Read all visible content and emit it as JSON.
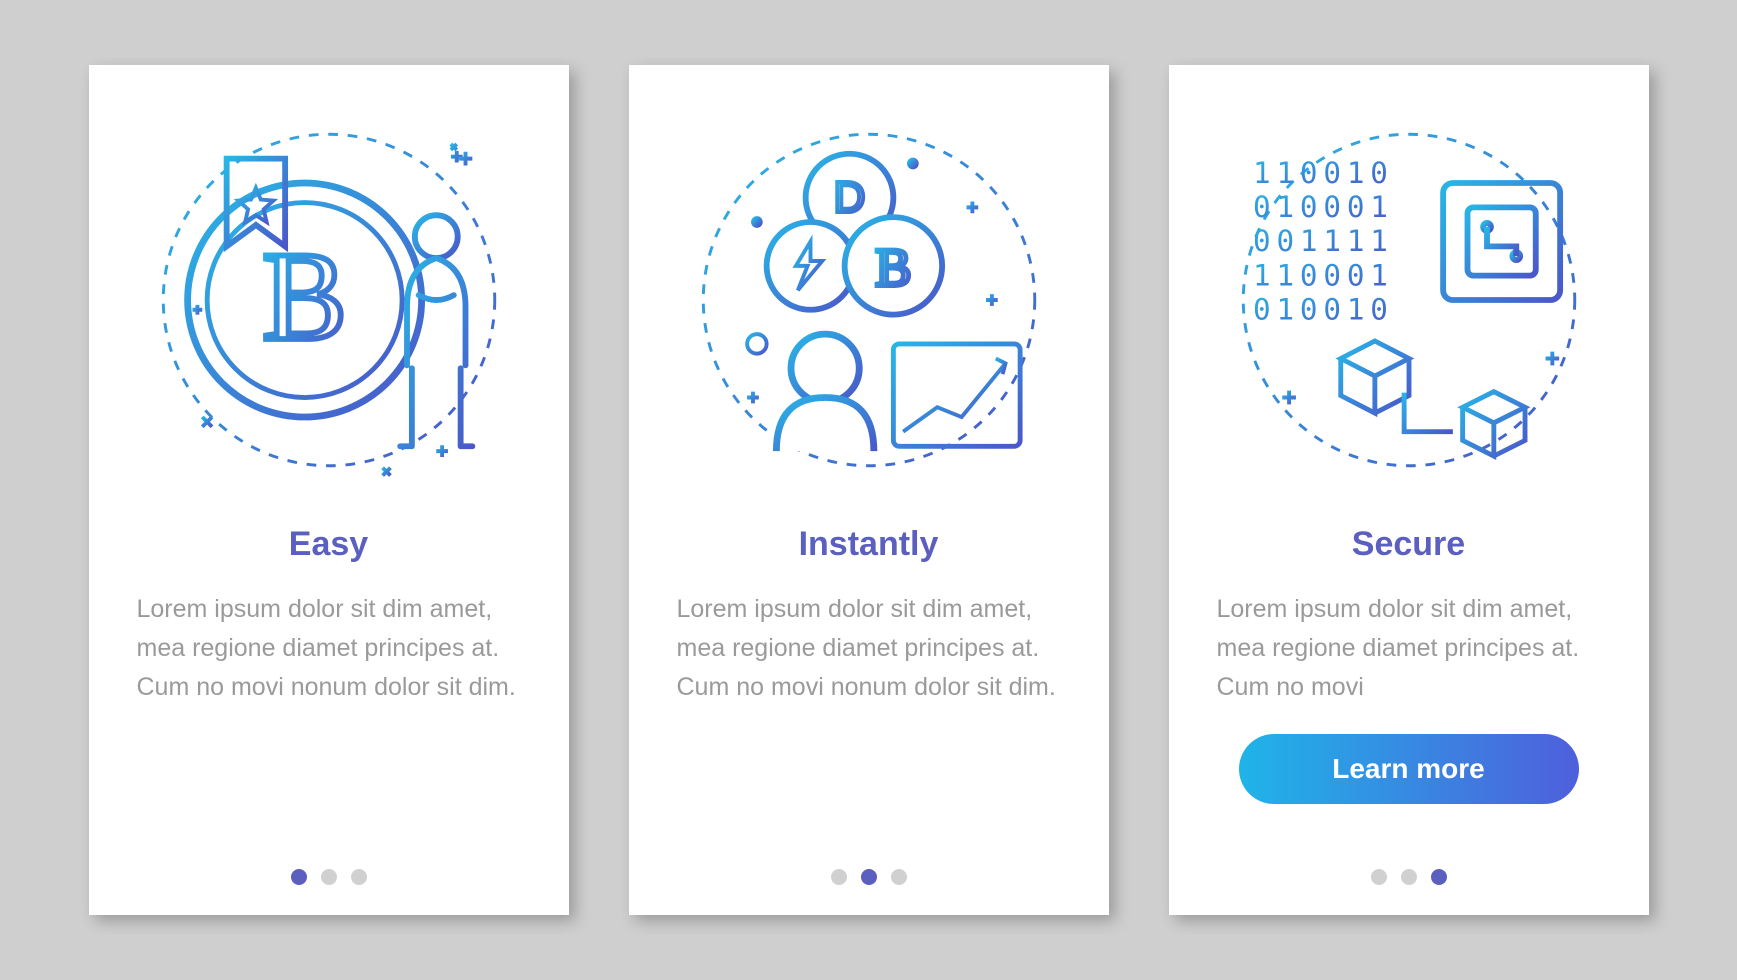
{
  "cards": [
    {
      "title": "Easy",
      "body": "Lorem ipsum dolor sit dim amet, mea regione diamet principes at. Cum no movi nonum dolor sit dim.",
      "cta": null,
      "active_dot": 0,
      "icon": "bitcoin-person-icon"
    },
    {
      "title": "Instantly",
      "body": "Lorem ipsum dolor sit dim amet, mea regione diamet principes at. Cum no movi nonum dolor sit dim.",
      "cta": null,
      "active_dot": 1,
      "icon": "crypto-chart-icon"
    },
    {
      "title": "Secure",
      "body": "Lorem ipsum dolor sit dim amet, mea regione diamet principes at. Cum no movi",
      "cta": "Learn more",
      "active_dot": 2,
      "icon": "binary-chip-icon"
    }
  ],
  "colors": {
    "accent": "#5b5fbf",
    "text_muted": "#9a9a9a",
    "gradient_start": "#1fb4e8",
    "gradient_end": "#4f5fdc"
  }
}
